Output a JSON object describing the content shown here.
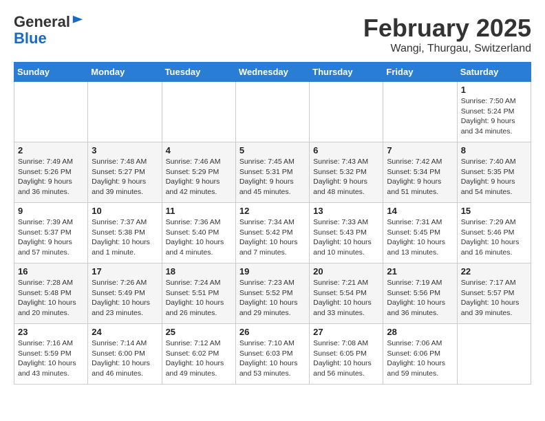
{
  "header": {
    "logo_line1": "General",
    "logo_line2": "Blue",
    "month_title": "February 2025",
    "location": "Wangi, Thurgau, Switzerland"
  },
  "weekdays": [
    "Sunday",
    "Monday",
    "Tuesday",
    "Wednesday",
    "Thursday",
    "Friday",
    "Saturday"
  ],
  "weeks": [
    [
      {
        "day": "",
        "info": ""
      },
      {
        "day": "",
        "info": ""
      },
      {
        "day": "",
        "info": ""
      },
      {
        "day": "",
        "info": ""
      },
      {
        "day": "",
        "info": ""
      },
      {
        "day": "",
        "info": ""
      },
      {
        "day": "1",
        "info": "Sunrise: 7:50 AM\nSunset: 5:24 PM\nDaylight: 9 hours\nand 34 minutes."
      }
    ],
    [
      {
        "day": "2",
        "info": "Sunrise: 7:49 AM\nSunset: 5:26 PM\nDaylight: 9 hours\nand 36 minutes."
      },
      {
        "day": "3",
        "info": "Sunrise: 7:48 AM\nSunset: 5:27 PM\nDaylight: 9 hours\nand 39 minutes."
      },
      {
        "day": "4",
        "info": "Sunrise: 7:46 AM\nSunset: 5:29 PM\nDaylight: 9 hours\nand 42 minutes."
      },
      {
        "day": "5",
        "info": "Sunrise: 7:45 AM\nSunset: 5:31 PM\nDaylight: 9 hours\nand 45 minutes."
      },
      {
        "day": "6",
        "info": "Sunrise: 7:43 AM\nSunset: 5:32 PM\nDaylight: 9 hours\nand 48 minutes."
      },
      {
        "day": "7",
        "info": "Sunrise: 7:42 AM\nSunset: 5:34 PM\nDaylight: 9 hours\nand 51 minutes."
      },
      {
        "day": "8",
        "info": "Sunrise: 7:40 AM\nSunset: 5:35 PM\nDaylight: 9 hours\nand 54 minutes."
      }
    ],
    [
      {
        "day": "9",
        "info": "Sunrise: 7:39 AM\nSunset: 5:37 PM\nDaylight: 9 hours\nand 57 minutes."
      },
      {
        "day": "10",
        "info": "Sunrise: 7:37 AM\nSunset: 5:38 PM\nDaylight: 10 hours\nand 1 minute."
      },
      {
        "day": "11",
        "info": "Sunrise: 7:36 AM\nSunset: 5:40 PM\nDaylight: 10 hours\nand 4 minutes."
      },
      {
        "day": "12",
        "info": "Sunrise: 7:34 AM\nSunset: 5:42 PM\nDaylight: 10 hours\nand 7 minutes."
      },
      {
        "day": "13",
        "info": "Sunrise: 7:33 AM\nSunset: 5:43 PM\nDaylight: 10 hours\nand 10 minutes."
      },
      {
        "day": "14",
        "info": "Sunrise: 7:31 AM\nSunset: 5:45 PM\nDaylight: 10 hours\nand 13 minutes."
      },
      {
        "day": "15",
        "info": "Sunrise: 7:29 AM\nSunset: 5:46 PM\nDaylight: 10 hours\nand 16 minutes."
      }
    ],
    [
      {
        "day": "16",
        "info": "Sunrise: 7:28 AM\nSunset: 5:48 PM\nDaylight: 10 hours\nand 20 minutes."
      },
      {
        "day": "17",
        "info": "Sunrise: 7:26 AM\nSunset: 5:49 PM\nDaylight: 10 hours\nand 23 minutes."
      },
      {
        "day": "18",
        "info": "Sunrise: 7:24 AM\nSunset: 5:51 PM\nDaylight: 10 hours\nand 26 minutes."
      },
      {
        "day": "19",
        "info": "Sunrise: 7:23 AM\nSunset: 5:52 PM\nDaylight: 10 hours\nand 29 minutes."
      },
      {
        "day": "20",
        "info": "Sunrise: 7:21 AM\nSunset: 5:54 PM\nDaylight: 10 hours\nand 33 minutes."
      },
      {
        "day": "21",
        "info": "Sunrise: 7:19 AM\nSunset: 5:56 PM\nDaylight: 10 hours\nand 36 minutes."
      },
      {
        "day": "22",
        "info": "Sunrise: 7:17 AM\nSunset: 5:57 PM\nDaylight: 10 hours\nand 39 minutes."
      }
    ],
    [
      {
        "day": "23",
        "info": "Sunrise: 7:16 AM\nSunset: 5:59 PM\nDaylight: 10 hours\nand 43 minutes."
      },
      {
        "day": "24",
        "info": "Sunrise: 7:14 AM\nSunset: 6:00 PM\nDaylight: 10 hours\nand 46 minutes."
      },
      {
        "day": "25",
        "info": "Sunrise: 7:12 AM\nSunset: 6:02 PM\nDaylight: 10 hours\nand 49 minutes."
      },
      {
        "day": "26",
        "info": "Sunrise: 7:10 AM\nSunset: 6:03 PM\nDaylight: 10 hours\nand 53 minutes."
      },
      {
        "day": "27",
        "info": "Sunrise: 7:08 AM\nSunset: 6:05 PM\nDaylight: 10 hours\nand 56 minutes."
      },
      {
        "day": "28",
        "info": "Sunrise: 7:06 AM\nSunset: 6:06 PM\nDaylight: 10 hours\nand 59 minutes."
      },
      {
        "day": "",
        "info": ""
      }
    ]
  ]
}
